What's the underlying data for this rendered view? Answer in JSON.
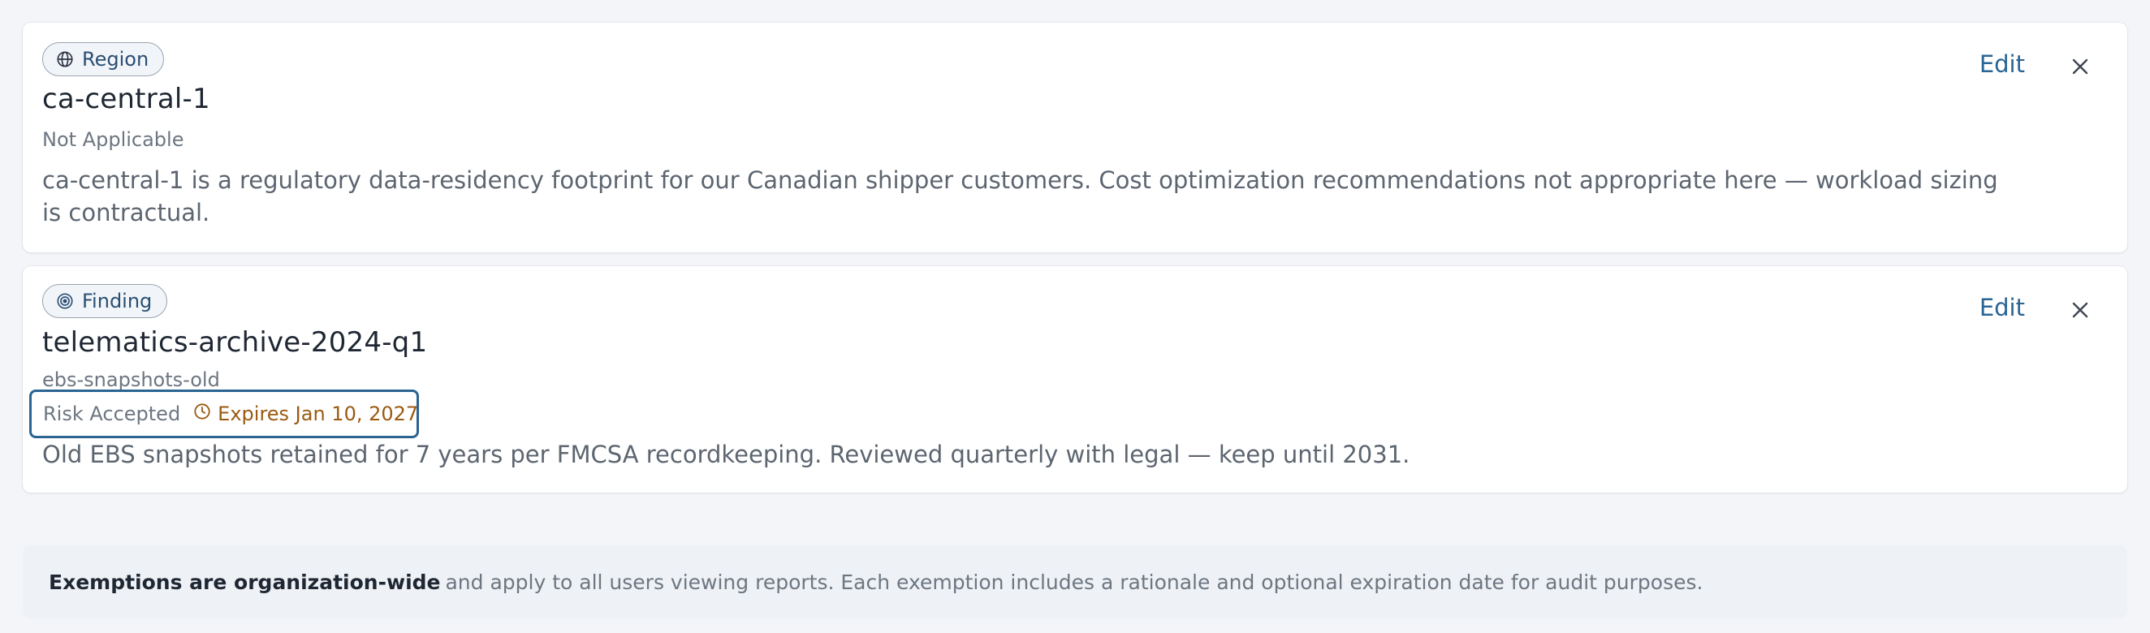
{
  "exemptions": [
    {
      "badge": {
        "label": "Region",
        "icon": "globe-icon"
      },
      "title": "ca-central-1",
      "subtitle": "Not Applicable",
      "description": "ca-central-1 is a regulatory data-residency footprint for our Canadian shipper customers. Cost optimization recommendations not appropriate here — workload sizing is contractual.",
      "edit_label": "Edit"
    },
    {
      "badge": {
        "label": "Finding",
        "icon": "target-icon"
      },
      "title": "telematics-archive-2024-q1",
      "subtitle": "ebs-snapshots-old",
      "status": "Risk Accepted",
      "expires": "Expires Jan 10, 2027",
      "description": "Old EBS snapshots retained for 7 years per FMCSA recordkeeping. Reviewed quarterly with legal — keep until 2031.",
      "edit_label": "Edit"
    }
  ],
  "footer": {
    "bold": "Exemptions are organization-wide",
    "text": "and apply to all users viewing reports. Each exemption includes a rationale and optional expiration date for audit purposes."
  },
  "colors": {
    "accent": "#2a6493",
    "expires": "#9a5a12",
    "muted": "#6d7681",
    "background": "#f3f5f8"
  }
}
